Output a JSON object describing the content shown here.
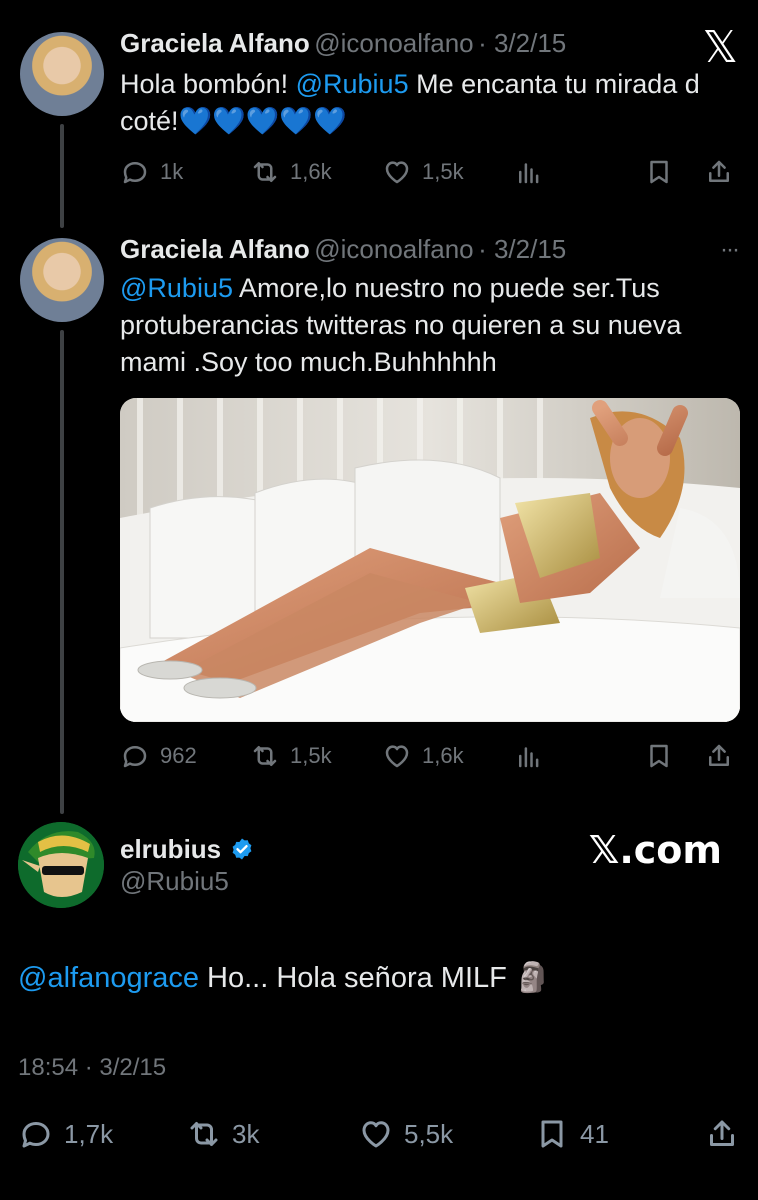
{
  "tweet1": {
    "name": "Graciela Alfano",
    "handle": "@iconoalfano",
    "date": "· 3/2/15",
    "text_pre": "Hola bombón! ",
    "mention": "@Rubiu5",
    "text_post": " Me encanta tu mirada d coté!",
    "hearts": "💙💙💙💙💙",
    "replies": "1k",
    "retweets": "1,6k",
    "likes": "1,5k"
  },
  "tweet2": {
    "name": "Graciela Alfano",
    "handle": "@iconoalfano",
    "date": "· 3/2/15",
    "mention": "@Rubiu5",
    "text": " Amore,lo nuestro no puede ser.Tus protuberancias twitteras no quieren a su nueva mami .Soy too much.Buhhhhhh",
    "replies": "962",
    "retweets": "1,5k",
    "likes": "1,6k",
    "more": "···"
  },
  "tweet3": {
    "name": "elrubius",
    "handle": "@Rubiu5",
    "mention": "@alfanograce",
    "text": " Ho... Hola señora MILF ",
    "emoji": "🗿",
    "timestamp": "18:54 · 3/2/15",
    "replies": "1,7k",
    "retweets": "3k",
    "likes": "5,5k",
    "bookmarks": "41"
  },
  "brand": {
    "logo": "𝕏",
    "domain": "𝕏.com"
  },
  "colors": {
    "background": "#000000",
    "mention": "#1d9bf0",
    "muted": "#71767b",
    "verified": "#1d9bf0"
  }
}
